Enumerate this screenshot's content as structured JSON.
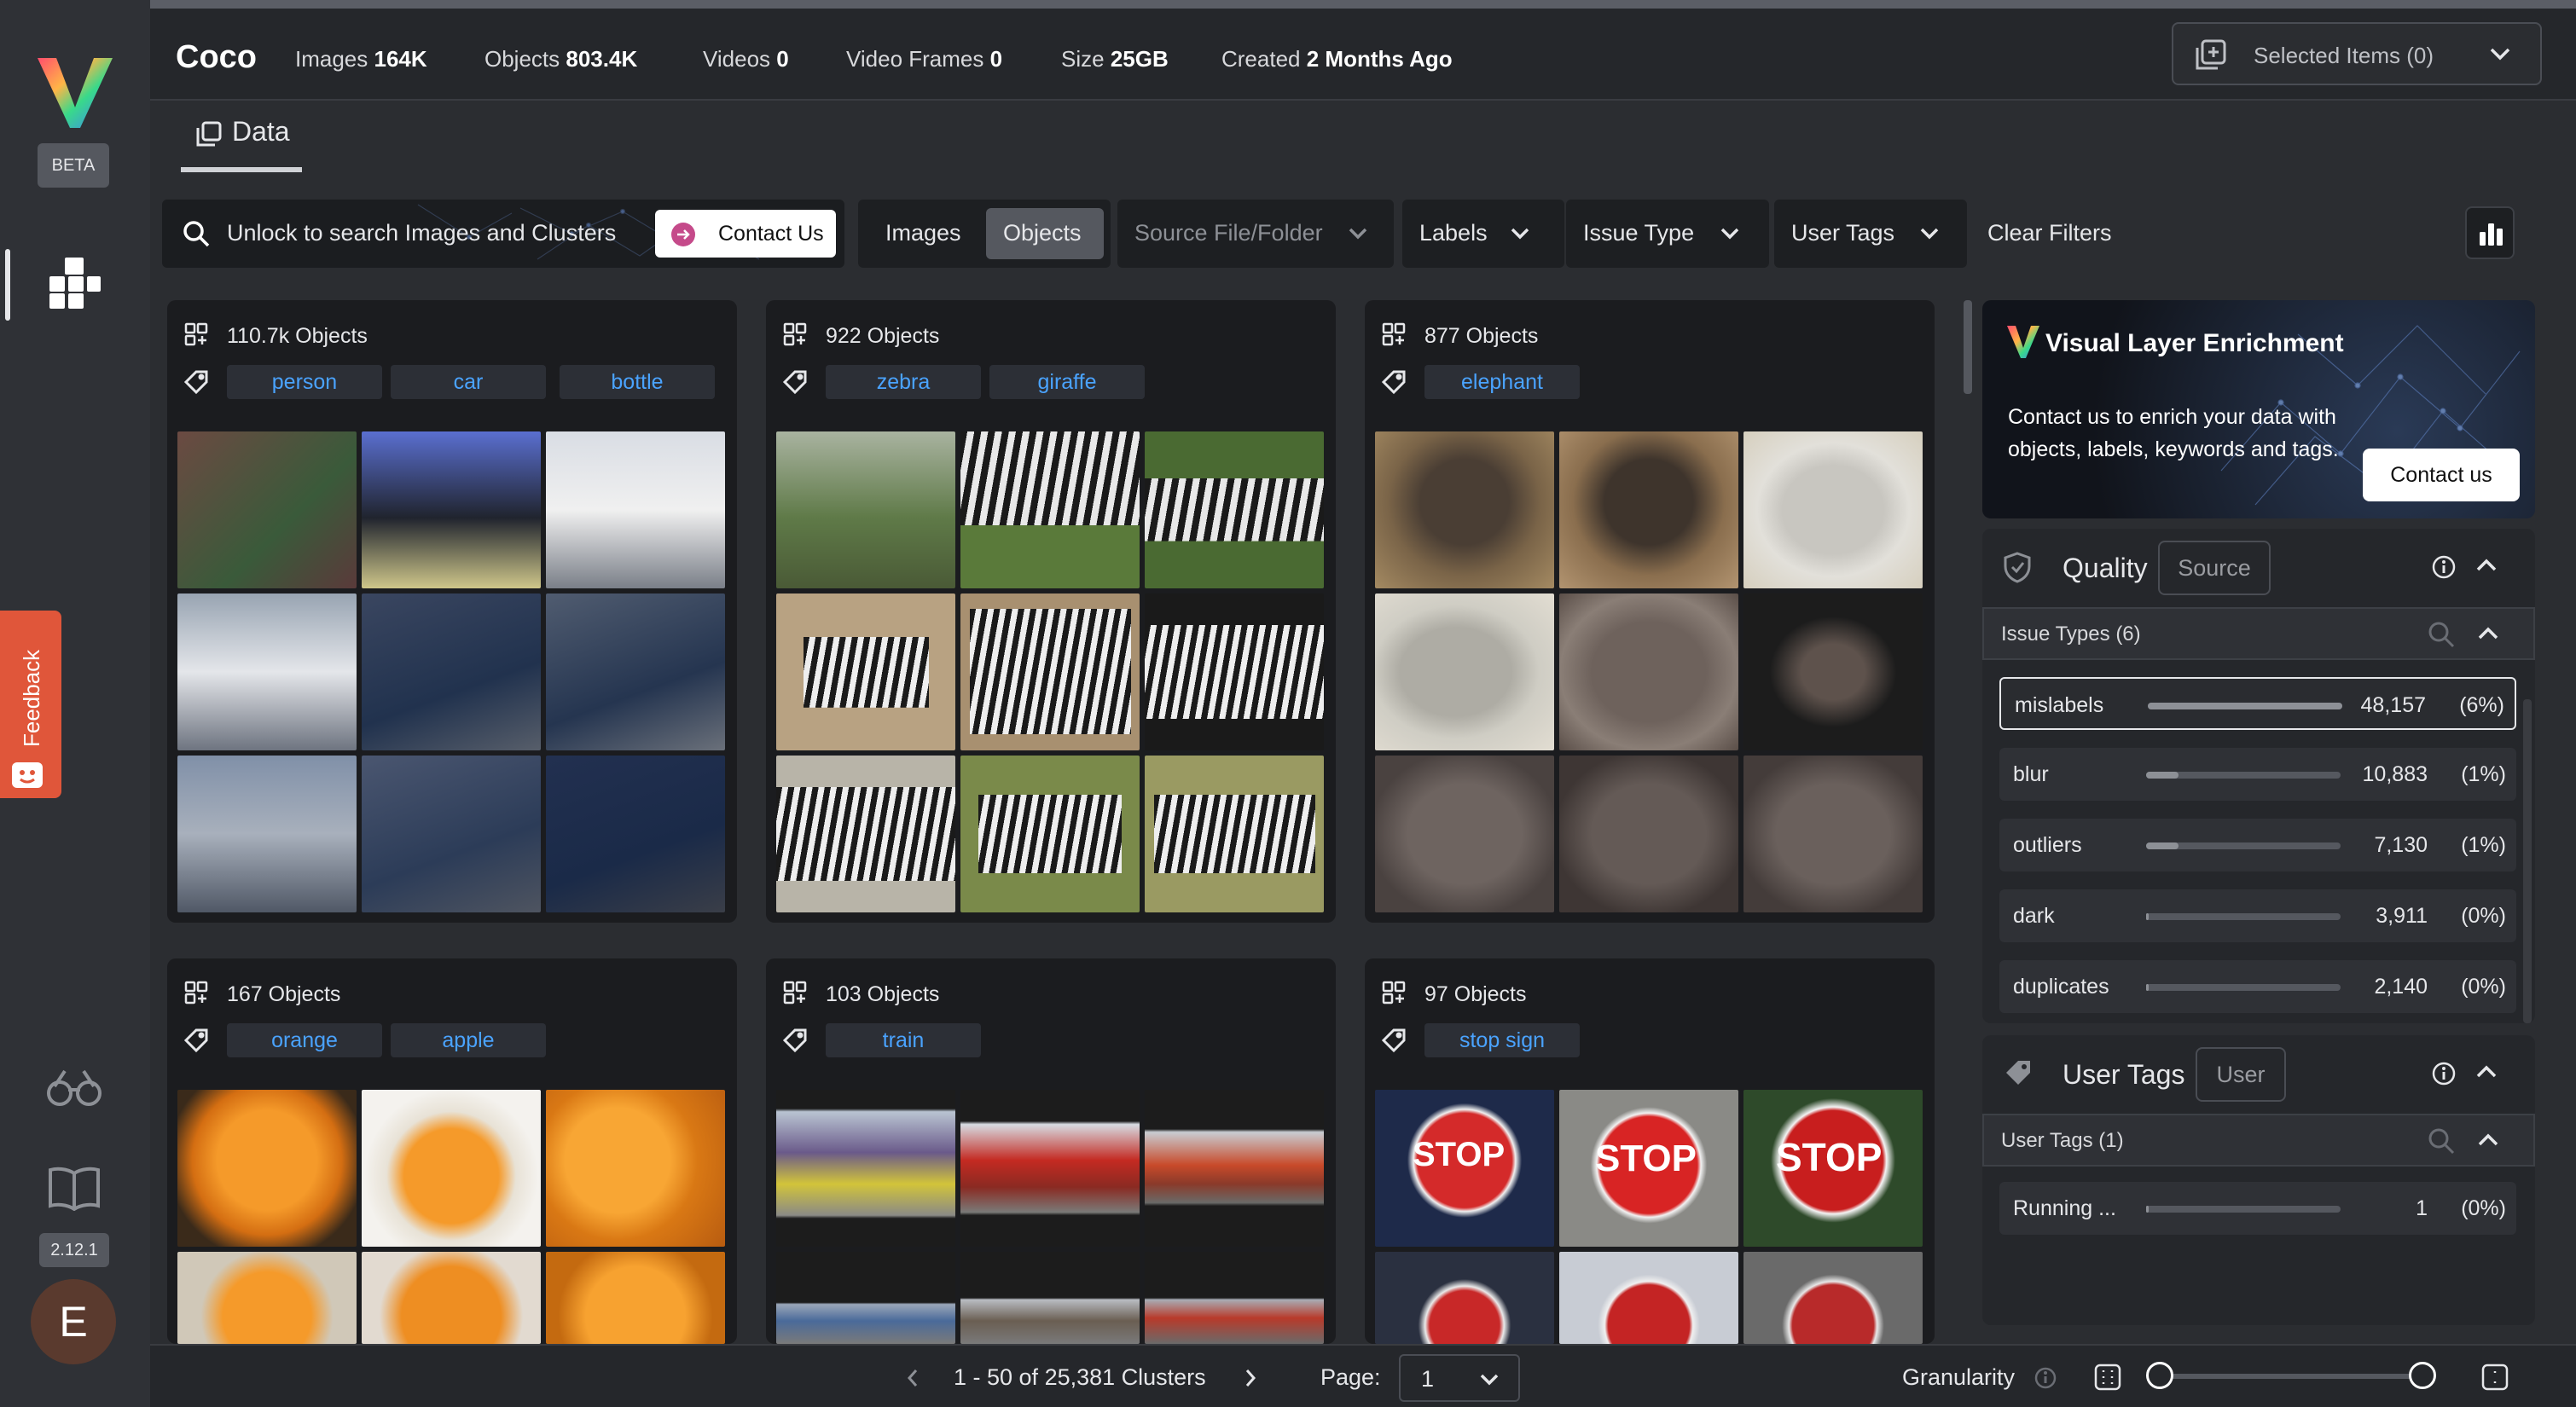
{
  "rail": {
    "beta": "BETA",
    "feedback": "Feedback",
    "version": "2.12.1",
    "avatar_initial": "E"
  },
  "topbar": {
    "dataset_name": "Coco",
    "stats": [
      {
        "label": "Images",
        "value": "164K"
      },
      {
        "label": "Objects",
        "value": "803.4K"
      },
      {
        "label": "Videos",
        "value": "0"
      },
      {
        "label": "Video Frames",
        "value": "0"
      },
      {
        "label": "Size",
        "value": "25GB"
      },
      {
        "label": "Created",
        "value": "2 Months Ago"
      }
    ],
    "selected_items": "Selected Items (0)"
  },
  "tabs": {
    "data": "Data"
  },
  "filters": {
    "search_text": "Unlock to search Images and Clusters",
    "contact_us": "Contact Us",
    "images": "Images",
    "objects": "Objects",
    "source": "Source File/Folder",
    "labels": "Labels",
    "issue_type": "Issue Type",
    "user_tags": "User Tags",
    "clear": "Clear Filters"
  },
  "clusters": [
    {
      "count": "110.7k Objects",
      "tags": [
        "person",
        "car",
        "bottle"
      ]
    },
    {
      "count": "922 Objects",
      "tags": [
        "zebra",
        "giraffe"
      ]
    },
    {
      "count": "877 Objects",
      "tags": [
        "elephant"
      ]
    },
    {
      "count": "167 Objects",
      "tags": [
        "orange",
        "apple"
      ]
    },
    {
      "count": "103 Objects",
      "tags": [
        "train"
      ]
    },
    {
      "count": "97 Objects",
      "tags": [
        "stop sign"
      ]
    }
  ],
  "enrichment": {
    "title": "Visual Layer Enrichment",
    "desc": "Contact us to enrich your data with objects, labels, keywords and tags.",
    "button": "Contact us"
  },
  "quality": {
    "title": "Quality",
    "source_btn": "Source",
    "issue_types_label": "Issue Types",
    "issue_types_count": "(6)",
    "issues": [
      {
        "name": "mislabels",
        "count": "48,157",
        "pct": "(6%)",
        "fraction": 0.06
      },
      {
        "name": "blur",
        "count": "10,883",
        "pct": "(1%)",
        "fraction": 0.01
      },
      {
        "name": "outliers",
        "count": "7,130",
        "pct": "(1%)",
        "fraction": 0.01
      },
      {
        "name": "dark",
        "count": "3,911",
        "pct": "(0%)",
        "fraction": 0.0
      },
      {
        "name": "duplicates",
        "count": "2,140",
        "pct": "(0%)",
        "fraction": 0.0
      }
    ]
  },
  "user_tags": {
    "title": "User Tags",
    "user_btn": "User",
    "list_label": "User Tags",
    "list_count": "(1)",
    "tags": [
      {
        "name": "Running ...",
        "count": "1",
        "pct": "(0%)",
        "fraction": 0.0
      }
    ]
  },
  "pagination": {
    "range": "1 - 50 of 25,381 Clusters",
    "page_label": "Page:",
    "page_value": "1",
    "granularity": "Granularity"
  },
  "colors": {
    "accent_link": "#4aa3ff",
    "feedback": "#e0563a"
  }
}
